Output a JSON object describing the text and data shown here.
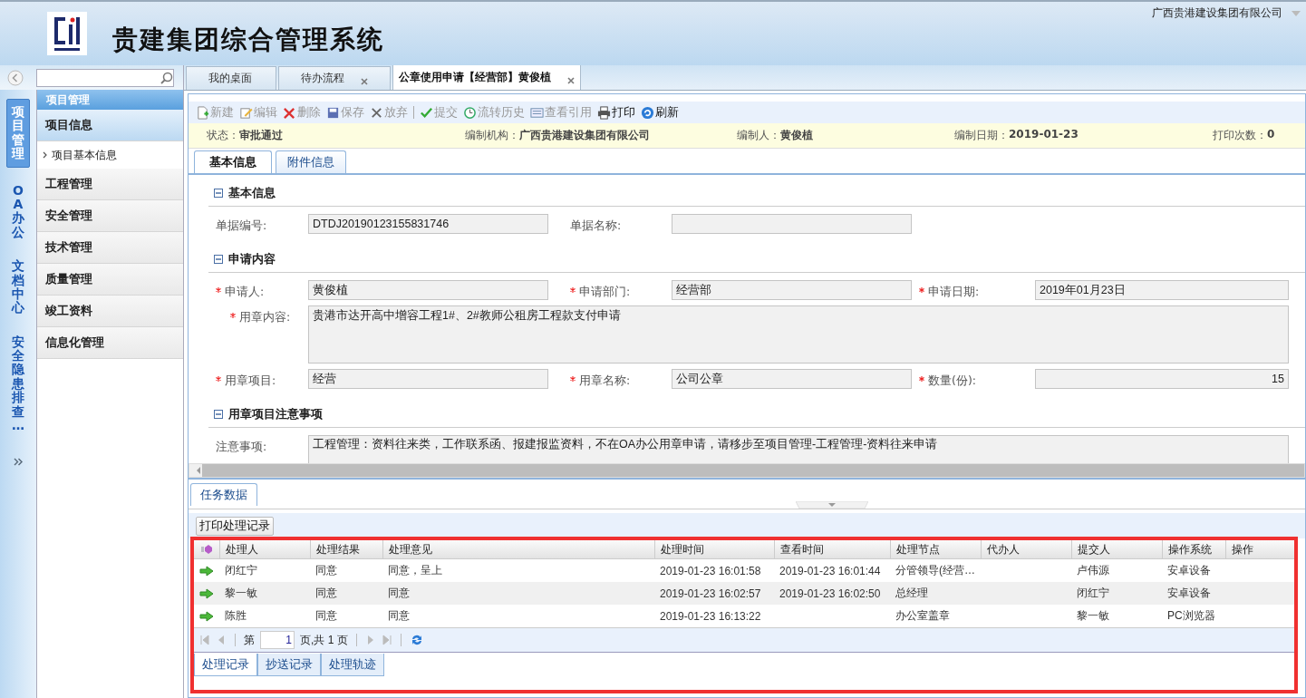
{
  "header": {
    "title": "贵建集团综合管理系统",
    "company": "广西贵港建设集团有限公司"
  },
  "nav_rail": [
    {
      "label": "项目管理",
      "selected": true
    },
    {
      "label": "OA办公",
      "selected": false
    },
    {
      "label": "文档中心",
      "selected": false
    },
    {
      "label": "安全隐患排查…",
      "selected": false
    }
  ],
  "sidebar": {
    "header": "项目管理",
    "items": [
      {
        "label": "项目信息",
        "expanded": true,
        "children": [
          {
            "label": "项目基本信息",
            "selected": false
          }
        ]
      },
      {
        "label": "工程管理",
        "expanded": false
      },
      {
        "label": "安全管理",
        "expanded": false
      },
      {
        "label": "技术管理",
        "expanded": false
      },
      {
        "label": "质量管理",
        "expanded": false
      },
      {
        "label": "竣工资料",
        "expanded": false
      },
      {
        "label": "信息化管理",
        "expanded": false
      }
    ]
  },
  "tabs": [
    {
      "label": "我的桌面",
      "selected": false,
      "closable": false
    },
    {
      "label": "待办流程",
      "selected": false,
      "closable": true
    },
    {
      "label": "公章使用申请【经营部】黄俊植",
      "selected": true,
      "closable": true
    }
  ],
  "toolbar": [
    {
      "label": "新建",
      "disabled": true
    },
    {
      "label": "编辑",
      "disabled": true
    },
    {
      "label": "删除",
      "disabled": true
    },
    {
      "label": "保存",
      "disabled": true
    },
    {
      "label": "放弃",
      "disabled": true
    },
    {
      "label": "提交",
      "disabled": true
    },
    {
      "label": "流转历史",
      "disabled": true
    },
    {
      "label": "查看引用",
      "disabled": true
    },
    {
      "label": "打印",
      "disabled": false
    },
    {
      "label": "刷新",
      "disabled": false
    }
  ],
  "status": [
    {
      "label": "状态：",
      "value": "审批通过"
    },
    {
      "label": "编制机构：",
      "value": "广西贵港建设集团有限公司"
    },
    {
      "label": "编制人：",
      "value": "黄俊植"
    },
    {
      "label": "编制日期：",
      "value": "2019-01-23"
    },
    {
      "label": "打印次数：",
      "value": "0"
    }
  ],
  "form_tabs": [
    {
      "label": "基本信息",
      "selected": true
    },
    {
      "label": "附件信息",
      "selected": false
    }
  ],
  "sections": [
    {
      "title": "基本信息",
      "fields": [
        {
          "label": "单据编号:",
          "value": "DTDJ20190123155831746",
          "required": false,
          "kind": "text"
        },
        {
          "label": "单据名称:",
          "required": false,
          "kind": "text"
        }
      ]
    },
    {
      "title": "申请内容",
      "fields": [
        {
          "label": "申请人:",
          "value": "黄俊植",
          "required": true,
          "kind": "text"
        },
        {
          "label": "申请部门:",
          "value": "经营部",
          "required": true,
          "kind": "text"
        },
        {
          "label": "申请日期:",
          "value": "2019年01月23日",
          "required": true,
          "kind": "text"
        },
        {
          "label": "用章内容:",
          "value": "贵港市达开高中增容工程1#、2#教师公租房工程款支付申请",
          "required": true,
          "kind": "textarea"
        },
        {
          "label": "用章项目:",
          "value": "经营",
          "required": true,
          "kind": "text"
        },
        {
          "label": "用章名称:",
          "value": "公司公章",
          "required": true,
          "kind": "text"
        },
        {
          "label": "数量(份):",
          "value": "15",
          "required": true,
          "kind": "number"
        }
      ]
    },
    {
      "title": "用章项目注意事项",
      "fields": [
        {
          "label": "注意事项:",
          "value": "工程管理：资料往来类，工作联系函、报建报监资料，不在OA办公用章申请，请移步至项目管理-工程管理-资料往来申请",
          "required": false,
          "kind": "note"
        }
      ]
    }
  ],
  "task_tabs": [
    "任务数据"
  ],
  "print_button": "打印处理记录",
  "grid": {
    "columns": [
      "处理人",
      "处理结果",
      "处理意见",
      "处理时间",
      "查看时间",
      "处理节点",
      "代办人",
      "提交人",
      "操作系统",
      "操作"
    ],
    "rows": [
      [
        "闭红宁",
        "同意",
        "同意，呈上",
        "2019-01-23 16:01:58",
        "2019-01-23 16:01:44",
        "分管领导(经营…",
        "",
        "卢伟源",
        "安卓设备",
        ""
      ],
      [
        "黎一敏",
        "同意",
        "同意",
        "2019-01-23 16:02:57",
        "2019-01-23 16:02:50",
        "总经理",
        "",
        "闭红宁",
        "安卓设备",
        ""
      ],
      [
        "陈胜",
        "同意",
        "同意",
        "2019-01-23 16:13:22",
        "",
        "办公室盖章",
        "",
        "黎一敏",
        "PC浏览器",
        ""
      ]
    ]
  },
  "pager": {
    "before": "第",
    "page": "1",
    "after": "页,共 1 页"
  },
  "bottom_tabs": [
    {
      "label": "处理记录",
      "selected": true
    },
    {
      "label": "抄送记录",
      "selected": false
    },
    {
      "label": "处理轨迹",
      "selected": false
    }
  ]
}
